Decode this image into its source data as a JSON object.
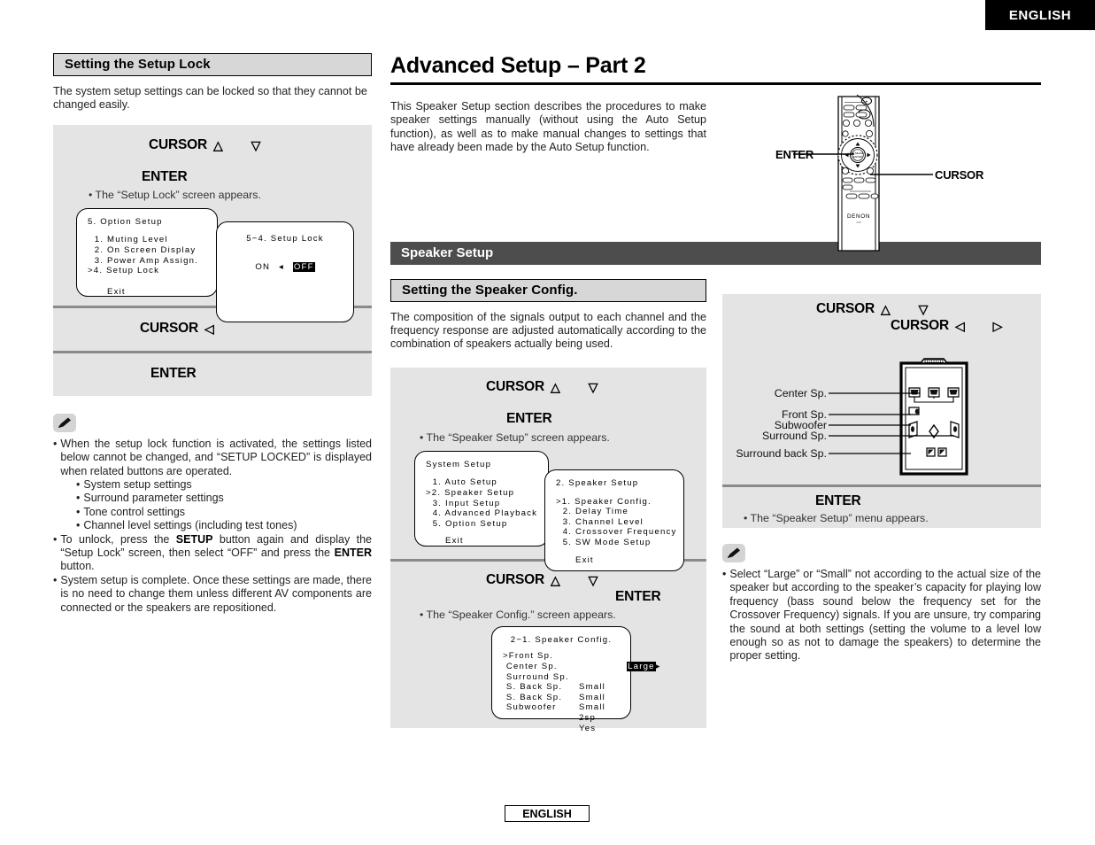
{
  "language_tab_top": "ENGLISH",
  "language_tab_bottom": "ENGLISH",
  "left_column": {
    "section_heading": "Setting the Setup Lock",
    "intro": "The system setup settings can be locked so that they cannot be changed easily.",
    "step1": {
      "cursor_label": "CURSOR",
      "cursor_up": "△",
      "cursor_down": "▽",
      "enter_label": "ENTER",
      "note": "• The “Setup Lock” screen appears."
    },
    "osd_option_setup": {
      "title": "5. Option Setup",
      "rows": [
        "  1. Muting Level",
        "  2. On Screen Display",
        "  3. Power Amp Assign.",
        ">4. Setup Lock"
      ],
      "exit": "Exit"
    },
    "osd_setup_lock": {
      "title": "5−4. Setup Lock",
      "option_on": "ON",
      "arrow": "◂",
      "option_off": "OFF"
    },
    "step2": {
      "cursor_label": "CURSOR",
      "cursor_left": "◁"
    },
    "step3": {
      "enter_label": "ENTER"
    },
    "notes": [
      "When the setup lock function is activated, the settings listed below cannot be changed, and “SETUP LOCKED” is displayed when related buttons are operated.",
      "To unlock, press the SETUP button again and display the “Setup Lock” screen, then select “OFF” and press the ENTER button.",
      "System setup is complete. Once these settings are made, there is no need to change them unless different AV components are connected or the speakers are repositioned."
    ],
    "note_sublist": [
      "System setup settings",
      "Surround parameter settings",
      "Tone control settings",
      "Channel level settings (including test tones)"
    ]
  },
  "mid_column": {
    "page_title": "Advanced Setup – Part 2",
    "intro": "This Speaker Setup section describes the procedures to make speaker settings manually (without using the Auto Setup function), as well as to make manual changes to settings that have already been made by the Auto Setup function.",
    "band_heading": "Speaker Setup",
    "section_heading": "Setting the Speaker Config.",
    "section_intro": "The composition of the signals output to each channel and the frequency response are adjusted automatically according to the combination of speakers actually being used.",
    "step1": {
      "cursor_label": "CURSOR",
      "cursor_up": "△",
      "cursor_down": "▽",
      "enter_label": "ENTER",
      "note": "• The “Speaker Setup” screen appears."
    },
    "osd_system_setup": {
      "title": "System Setup",
      "rows": [
        "  1. Auto Setup",
        ">2. Speaker Setup",
        "  3. Input Setup",
        "  4. Advanced Playback",
        "  5. Option Setup"
      ],
      "exit": "Exit"
    },
    "osd_speaker_setup": {
      "title": "2. Speaker Setup",
      "rows": [
        ">1. Speaker Config.",
        "  2. Delay Time",
        "  3. Channel Level",
        "  4. Crossover Frequency",
        "  5. SW Mode Setup"
      ],
      "exit": "Exit"
    },
    "step2": {
      "cursor_label": "CURSOR",
      "cursor_up": "△",
      "cursor_down": "▽",
      "enter_label": "ENTER",
      "note": "• The “Speaker Config.” screen appears."
    },
    "osd_speaker_config": {
      "title": "2−1. Speaker Config.",
      "rows": [
        {
          "name": ">Front Sp.",
          "value": "Large",
          "selected": true
        },
        {
          "name": " Center Sp.",
          "value": "Small",
          "selected": false
        },
        {
          "name": " Surround Sp.",
          "value": "Small",
          "selected": false
        },
        {
          "name": " S. Back Sp.",
          "value": "Small",
          "selected": false
        },
        {
          "name": " S. Back Sp.",
          "value": "2sp",
          "selected": false
        },
        {
          "name": " Subwoofer",
          "value": "Yes",
          "selected": false
        }
      ],
      "arrow": "▸"
    }
  },
  "right_column": {
    "remote": {
      "enter_label": "ENTER",
      "cursor_label": "CURSOR",
      "brand": "DENON"
    },
    "step": {
      "cursor_label_1": "CURSOR",
      "cursor_up": "△",
      "cursor_down": "▽",
      "cursor_label_2": "CURSOR",
      "cursor_left": "◁",
      "cursor_right": "▷"
    },
    "room_labels": [
      "Center Sp.",
      "Front Sp.",
      "Subwoofer",
      "Surround Sp.",
      "Surround back Sp."
    ],
    "enter_step": {
      "enter_label": "ENTER",
      "note": "• The “Speaker Setup” menu appears."
    },
    "note": "Select “Large” or “Small” not according to the actual size of the speaker but according to the speaker’s capacity for playing low frequency (bass sound below the frequency set for the Crossover Frequency) signals. If you are unsure, try comparing the sound at both settings (setting the volume to a level low enough so as not to damage the speakers) to determine the proper setting."
  },
  "colors": {
    "panel_gray": "#e4e4e4",
    "heading_gray": "#d7d7d7",
    "band_dark": "#4d4d4d",
    "rule_gray": "#8a8a8a"
  }
}
